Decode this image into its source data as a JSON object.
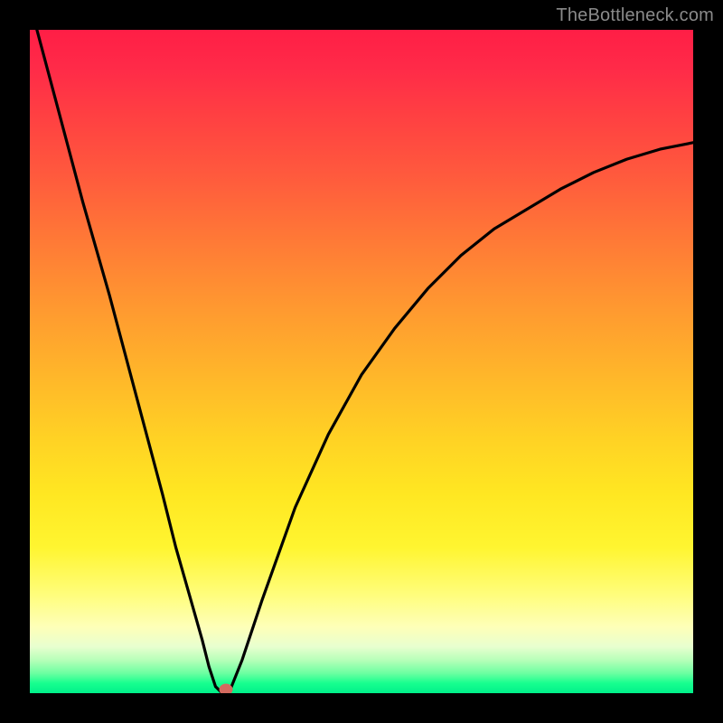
{
  "watermark": "TheBottleneck.com",
  "colors": {
    "frame": "#000000",
    "curve": "#000000",
    "marker": "#d46a5f"
  },
  "chart_data": {
    "type": "line",
    "title": "",
    "xlabel": "",
    "ylabel": "",
    "xlim": [
      0,
      100
    ],
    "ylim": [
      0,
      100
    ],
    "series": [
      {
        "name": "bottleneck-curve",
        "x": [
          0,
          4,
          8,
          12,
          16,
          20,
          22,
          24,
          26,
          27,
          28,
          29,
          30,
          32,
          35,
          40,
          45,
          50,
          55,
          60,
          65,
          70,
          75,
          80,
          85,
          90,
          95,
          100
        ],
        "y": [
          104,
          89,
          74,
          60,
          45,
          30,
          22,
          15,
          8,
          4,
          1,
          0,
          0,
          5,
          14,
          28,
          39,
          48,
          55,
          61,
          66,
          70,
          73,
          76,
          78.5,
          80.5,
          82,
          83
        ]
      }
    ],
    "marker": {
      "x": 29.5,
      "y": 0.5
    },
    "gradient_stops": [
      {
        "pos": 0.0,
        "color": "#ff1e46"
      },
      {
        "pos": 0.5,
        "color": "#ffc426"
      },
      {
        "pos": 0.85,
        "color": "#fffd7a"
      },
      {
        "pos": 1.0,
        "color": "#00f08a"
      }
    ]
  }
}
